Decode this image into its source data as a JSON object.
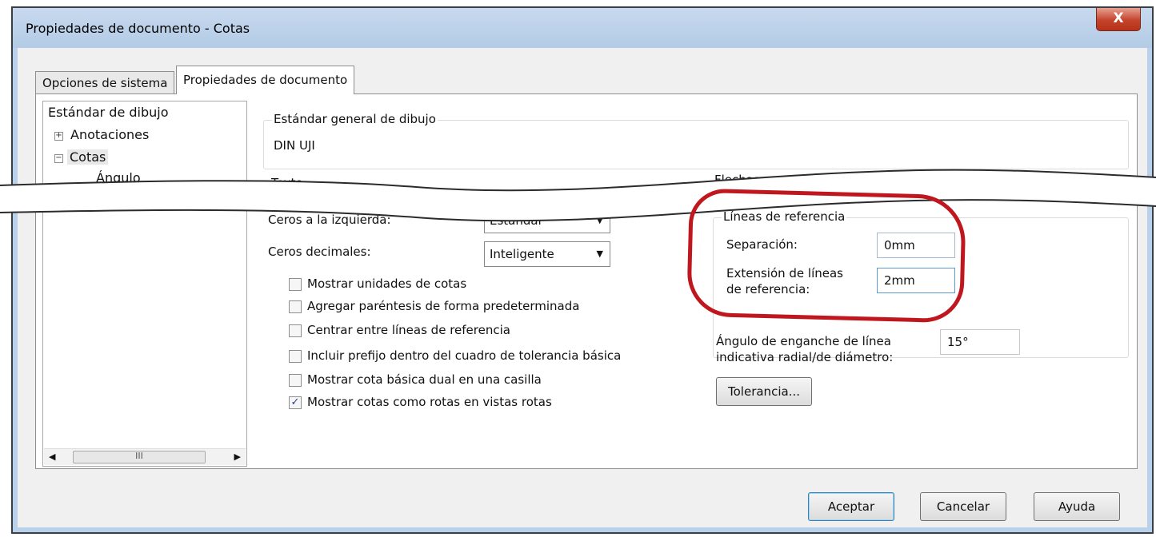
{
  "window": {
    "title": "Propiedades de documento - Cotas",
    "close": "X"
  },
  "tabs": [
    "Opciones de sistema",
    "Propiedades de documento"
  ],
  "tree": {
    "items": [
      "Estándar de dibujo",
      "Anotaciones",
      "Cotas",
      "Ángulo"
    ],
    "scroll_thumb": "III",
    "scroll_left": "◀",
    "scroll_right": "▶"
  },
  "general": {
    "title": "Estándar general de dibujo",
    "value": "DIN UJI"
  },
  "sections": {
    "texto": "Texto",
    "flechas": "Flechas"
  },
  "zeros": {
    "leading_label": "Ceros a la izquierda:",
    "leading_value": "Estándar",
    "decimal_label": "Ceros decimales:",
    "decimal_value": "Inteligente"
  },
  "checkboxes": [
    {
      "label": "Mostrar unidades de cotas",
      "checked": false
    },
    {
      "label": "Agregar paréntesis de forma predeterminada",
      "checked": false
    },
    {
      "label": "Centrar entre líneas de referencia",
      "checked": false
    },
    {
      "label": "Incluir prefijo dentro del cuadro de tolerancia básica",
      "checked": false
    },
    {
      "label": "Mostrar cota básica dual en una casilla",
      "checked": false
    },
    {
      "label": "Mostrar cotas como rotas en vistas rotas",
      "checked": true
    }
  ],
  "ref_lines": {
    "title": "Líneas de referencia",
    "gap_label": "Separación:",
    "gap_value": "0mm",
    "ext_label_1": "Extensión de líneas",
    "ext_label_2": "de referencia:",
    "ext_value": "2mm"
  },
  "snap": {
    "label_1": "Ángulo de enganche de línea",
    "label_2": "indicativa radial/de diámetro:",
    "value": "15°"
  },
  "buttons": {
    "tolerance": "Tolerancia...",
    "ok": "Aceptar",
    "cancel": "Cancelar",
    "help": "Ayuda"
  },
  "colors": {
    "annotation": "#c0161e",
    "titlebar": "#b9d1ea",
    "close": "#c4432c"
  }
}
